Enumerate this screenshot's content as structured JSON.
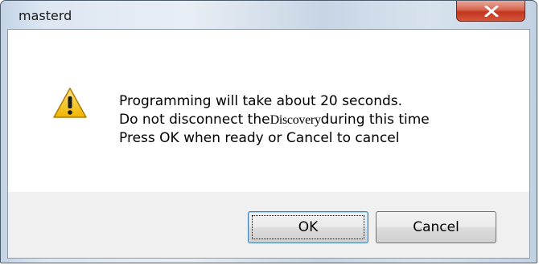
{
  "window": {
    "title": "masterd"
  },
  "dialog": {
    "icon": "warning-icon",
    "lines": {
      "line1": "Programming will take about 20 seconds.",
      "line2_prefix": "Do not disconnect the",
      "line2_device": "Discovery",
      "line2_suffix": "during this time",
      "line3": "Press OK when ready or Cancel to cancel"
    }
  },
  "buttons": {
    "ok_label": "OK",
    "cancel_label": "Cancel"
  },
  "colors": {
    "close_button": "#c2361e",
    "warning_fill": "#f5c518",
    "focus_border": "#3c7fb1"
  }
}
